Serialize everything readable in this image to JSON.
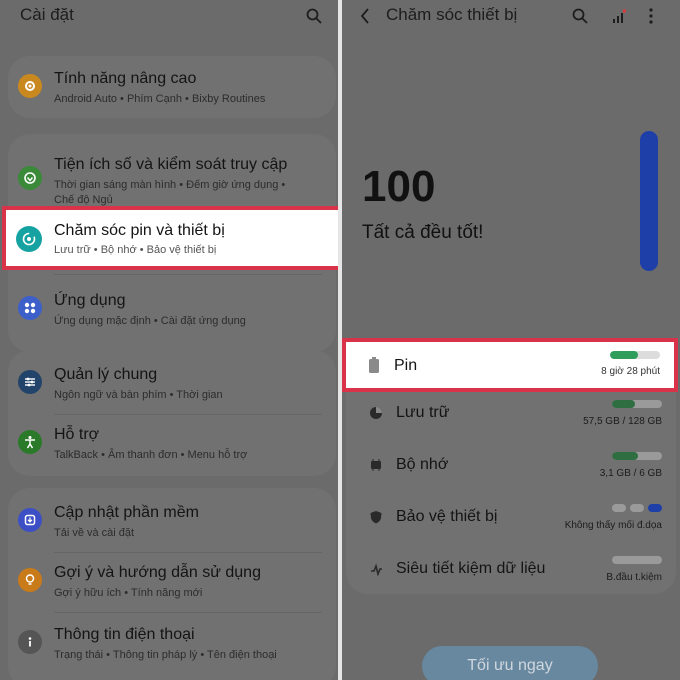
{
  "left": {
    "title": "Cài đặt",
    "items": [
      {
        "title": "Tính năng nâng cao",
        "sub": "Android Auto  •  Phím Cạnh  •  Bixby Routines",
        "icon": "gear-plus-icon",
        "color": "#c9891e"
      },
      {
        "title": "Tiện ích số và kiểm soát truy cập",
        "sub1": "Thời gian sáng màn hình  •  Đếm giờ ứng dụng  •",
        "sub2": "Chế độ Ngủ",
        "icon": "digital-wellbeing-icon",
        "color": "#3a8a3a"
      },
      {
        "title": "Chăm sóc pin và thiết bị",
        "sub": "Lưu trữ  •  Bộ nhớ  •  Bảo vệ thiết bị",
        "icon": "device-care-icon",
        "color": "#17a2a2"
      },
      {
        "title": "Ứng dụng",
        "sub": "Ứng dụng mặc định  •  Cài đặt ứng dụng",
        "icon": "apps-icon",
        "color": "#3c5fc9"
      },
      {
        "title": "Quản lý chung",
        "sub": "Ngôn ngữ và bàn phím  •  Thời gian",
        "icon": "sliders-icon",
        "color": "#22446a"
      },
      {
        "title": "Hỗ trợ",
        "sub": "TalkBack  •  Âm thanh đơn  •  Menu hỗ trợ",
        "icon": "accessibility-icon",
        "color": "#2a7a2a"
      },
      {
        "title": "Cập nhật phần mềm",
        "sub": "Tải về và cài đặt",
        "icon": "software-update-icon",
        "color": "#3d4fc4"
      },
      {
        "title": "Gợi ý và hướng dẫn sử dụng",
        "sub": "Gợi ý hữu ích  •  Tính năng mới",
        "icon": "tips-icon",
        "color": "#c97b1a"
      },
      {
        "title": "Thông tin điện thoại",
        "sub": "Trạng thái  •  Thông tin pháp lý  •  Tên điện thoại",
        "icon": "info-icon",
        "color": "#555555"
      }
    ]
  },
  "right": {
    "title": "Chăm sóc thiết bị",
    "score": "100",
    "status": "Tất cả đều tốt!",
    "rows": [
      {
        "label": "Pin",
        "value": "8 giờ 28 phút",
        "fill": 0.55,
        "icon": "battery-icon"
      },
      {
        "label": "Lưu trữ",
        "value": "57,5 GB / 128 GB",
        "fill": 0.45,
        "icon": "storage-pie-icon"
      },
      {
        "label": "Bộ nhớ",
        "value": "3,1 GB / 6 GB",
        "fill": 0.52,
        "icon": "memory-chip-icon"
      },
      {
        "label": "Bảo vệ thiết bị",
        "value": "Không thấy mối đ.dọa",
        "icon": "shield-icon"
      },
      {
        "label": "Siêu tiết kiệm dữ liệu",
        "value": "B.đầu t.kiệm",
        "icon": "data-saver-icon"
      }
    ],
    "optimize_label": "Tối ưu ngay"
  },
  "colors": {
    "highlight": "#d9334a",
    "accent_green": "#2f9e5a",
    "blue": "#1f3fa8"
  }
}
